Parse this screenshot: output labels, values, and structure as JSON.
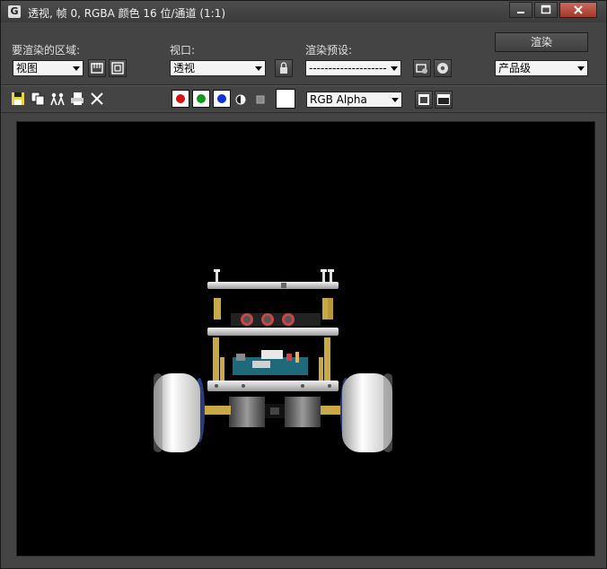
{
  "window": {
    "title": "透视, 帧 0, RGBA 颜色 16 位/通道 (1:1)",
    "app_icon": "3ds-max-icon",
    "controls": {
      "minimize": "minimize-icon",
      "maximize": "maximize-icon",
      "close": "close-icon"
    }
  },
  "area": {
    "label": "要渲染的区域:",
    "value": "视图"
  },
  "viewport_select": {
    "label": "视口:",
    "value": "透视"
  },
  "preset": {
    "label": "渲染预设:",
    "value": "--------------------"
  },
  "render_button": "渲染",
  "quality": {
    "value": "产品级"
  },
  "channel_display": {
    "value": "RGB Alpha"
  },
  "colors": {
    "red": "#d81010",
    "green": "#0a9a1a",
    "blue": "#1030d8",
    "background": "#000000"
  },
  "icons": [
    "save-image-icon",
    "copy-image-icon",
    "clone-window-icon",
    "print-icon",
    "clear-icon",
    "lock-icon",
    "edit-region-icon",
    "auto-region-icon",
    "render-setup-icon",
    "environment-icon",
    "monochrome-icon",
    "swatch-icon",
    "toggle-ui-overlay-icon",
    "toggle-ui-icon"
  ]
}
